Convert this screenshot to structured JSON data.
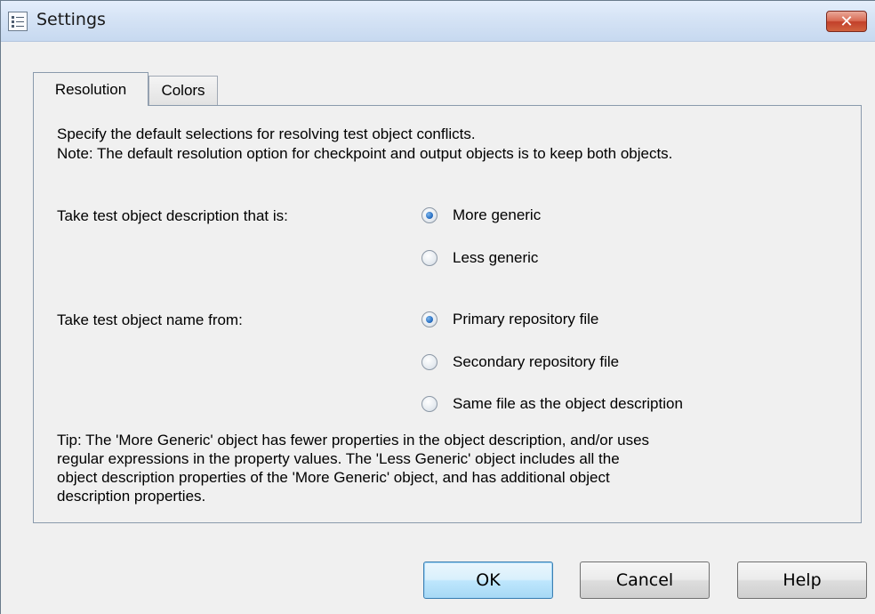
{
  "window": {
    "title": "Settings",
    "close_glyph": "✕"
  },
  "tabs": [
    {
      "label": "Resolution",
      "active": true
    },
    {
      "label": "Colors",
      "active": false
    }
  ],
  "panel": {
    "intro_line1": "Specify the default selections for resolving test object conflicts.",
    "intro_line2": "Note: The default resolution option for checkpoint and output objects is to keep both objects.",
    "description_group": {
      "label": "Take test object description that is:",
      "options": [
        {
          "label": "More generic",
          "checked": true
        },
        {
          "label": "Less generic",
          "checked": false
        }
      ]
    },
    "name_group": {
      "label": "Take test object name from:",
      "options": [
        {
          "label": "Primary repository file",
          "checked": true
        },
        {
          "label": "Secondary repository file",
          "checked": false
        },
        {
          "label": "Same file as the object description",
          "checked": false
        }
      ]
    },
    "tip": {
      "line1": "Tip: The 'More Generic' object has fewer properties in the object description, and/or uses",
      "line2": "regular expressions in the property values. The 'Less Generic' object includes all the",
      "line3": "object description properties of the 'More Generic' object, and has additional object",
      "line4": "description properties."
    }
  },
  "buttons": {
    "ok": "OK",
    "cancel": "Cancel",
    "help": "Help"
  },
  "icons": {
    "window": "settings-list-icon",
    "close": "close-icon"
  },
  "colors": {
    "titlebar": "#d5e3f5",
    "close": "#c2402a",
    "radio_dot": "#2a72c6",
    "dialog_bg": "#f0f0f0"
  }
}
